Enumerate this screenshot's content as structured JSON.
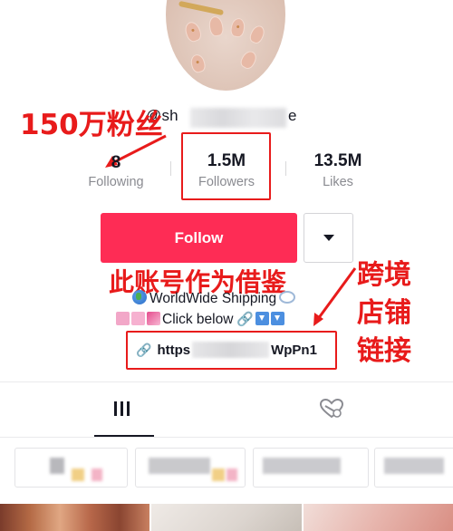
{
  "profile": {
    "username_prefix": "@sh",
    "username_suffix": "e"
  },
  "annotations": {
    "followers_note": "150万粉丝",
    "account_note": "此账号作为借鉴",
    "link_note_line1": "跨境",
    "link_note_line2": "店铺",
    "link_note_line3": "链接",
    "color": "#e81b1b"
  },
  "stats": {
    "following": {
      "value": "8",
      "label": "Following"
    },
    "followers": {
      "value": "1.5M",
      "label": "Followers"
    },
    "likes": {
      "value": "13.5M",
      "label": "Likes"
    }
  },
  "actions": {
    "follow_label": "Follow",
    "follow_color": "#fe2c55"
  },
  "bio": {
    "line1_text": "WorldWide Shipping",
    "line2_text": "Click below",
    "link_prefix": "https",
    "link_suffix": "WpPn1"
  },
  "tabs": {
    "videos_icon": "grid-icon",
    "liked_icon": "liked-heart-icon"
  }
}
